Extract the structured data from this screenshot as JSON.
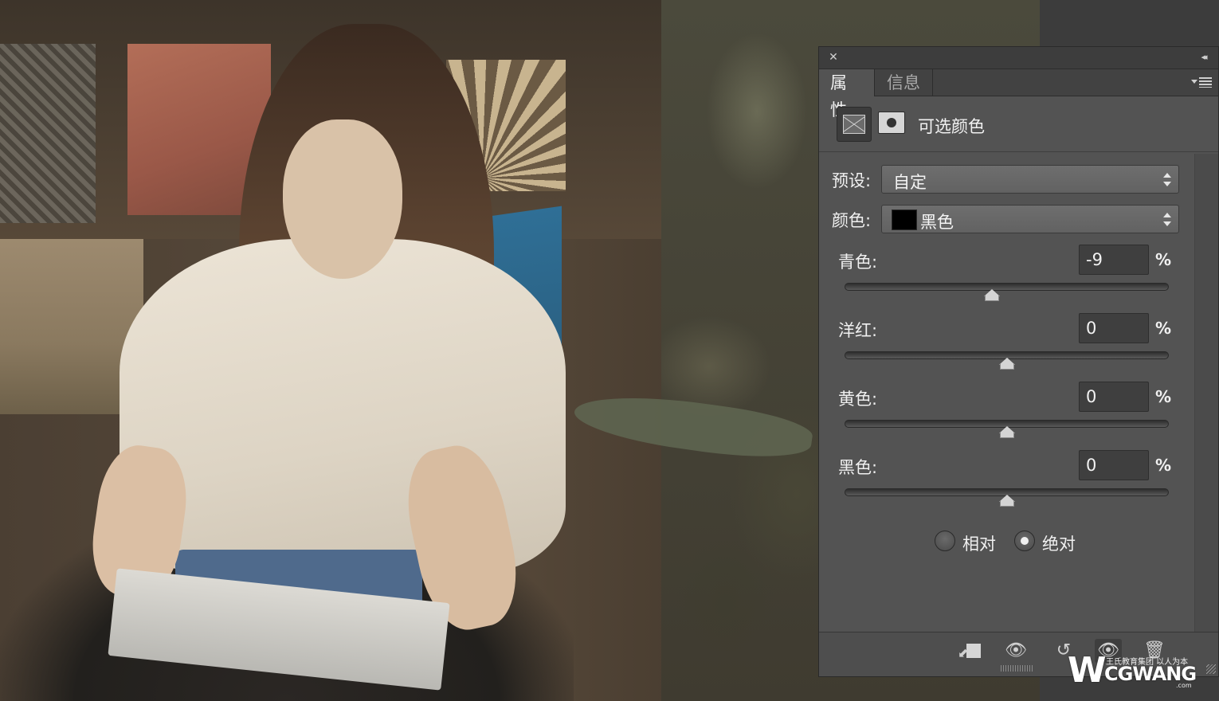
{
  "panel": {
    "close_glyph": "✕",
    "collapse_glyph": "◂◂",
    "tabs": [
      {
        "label": "属性",
        "active": true
      },
      {
        "label": "信息",
        "active": false
      }
    ],
    "adjustment": {
      "title": "可选颜色",
      "icons": [
        "selective-color-icon",
        "layer-mask-icon"
      ]
    },
    "preset": {
      "label": "预设:",
      "value": "自定"
    },
    "color": {
      "label": "颜色:",
      "value": "黑色",
      "swatch": "#000000"
    },
    "sliders": [
      {
        "label": "青色:",
        "value": "-9",
        "unit": "%",
        "level": -9
      },
      {
        "label": "洋红:",
        "value": "0",
        "unit": "%",
        "level": 0
      },
      {
        "label": "黄色:",
        "value": "0",
        "unit": "%",
        "level": 0
      },
      {
        "label": "黑色:",
        "value": "0",
        "unit": "%",
        "level": 0
      }
    ],
    "method": [
      {
        "label": "相对",
        "checked": false
      },
      {
        "label": "绝对",
        "checked": true
      }
    ],
    "footer_icons": [
      "clip-to-layer-icon",
      "view-previous-state-icon",
      "reset-icon",
      "visibility-icon",
      "trash-icon"
    ]
  },
  "watermark": {
    "logo": "W",
    "tagline": "王氏教育集团 以人为本",
    "brand": "CGWANG",
    "domain": ".com"
  }
}
